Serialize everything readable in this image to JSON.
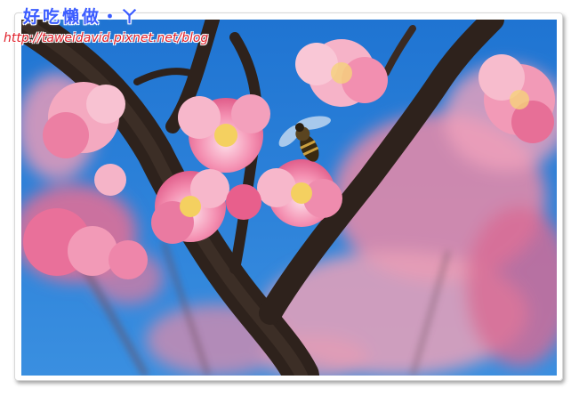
{
  "watermark": {
    "title": "好吃懶做・ㄚ",
    "url": "http://taweidavid.pixnet.net/blog"
  },
  "photo": {
    "subject": "cherry-blossom-with-bee",
    "colors": {
      "sky": "#2a7fd6",
      "blossom": "#f07aa0",
      "blossom_light": "#f9b8cc",
      "branch": "#3a2a22",
      "bee": "#3a2a10"
    }
  }
}
